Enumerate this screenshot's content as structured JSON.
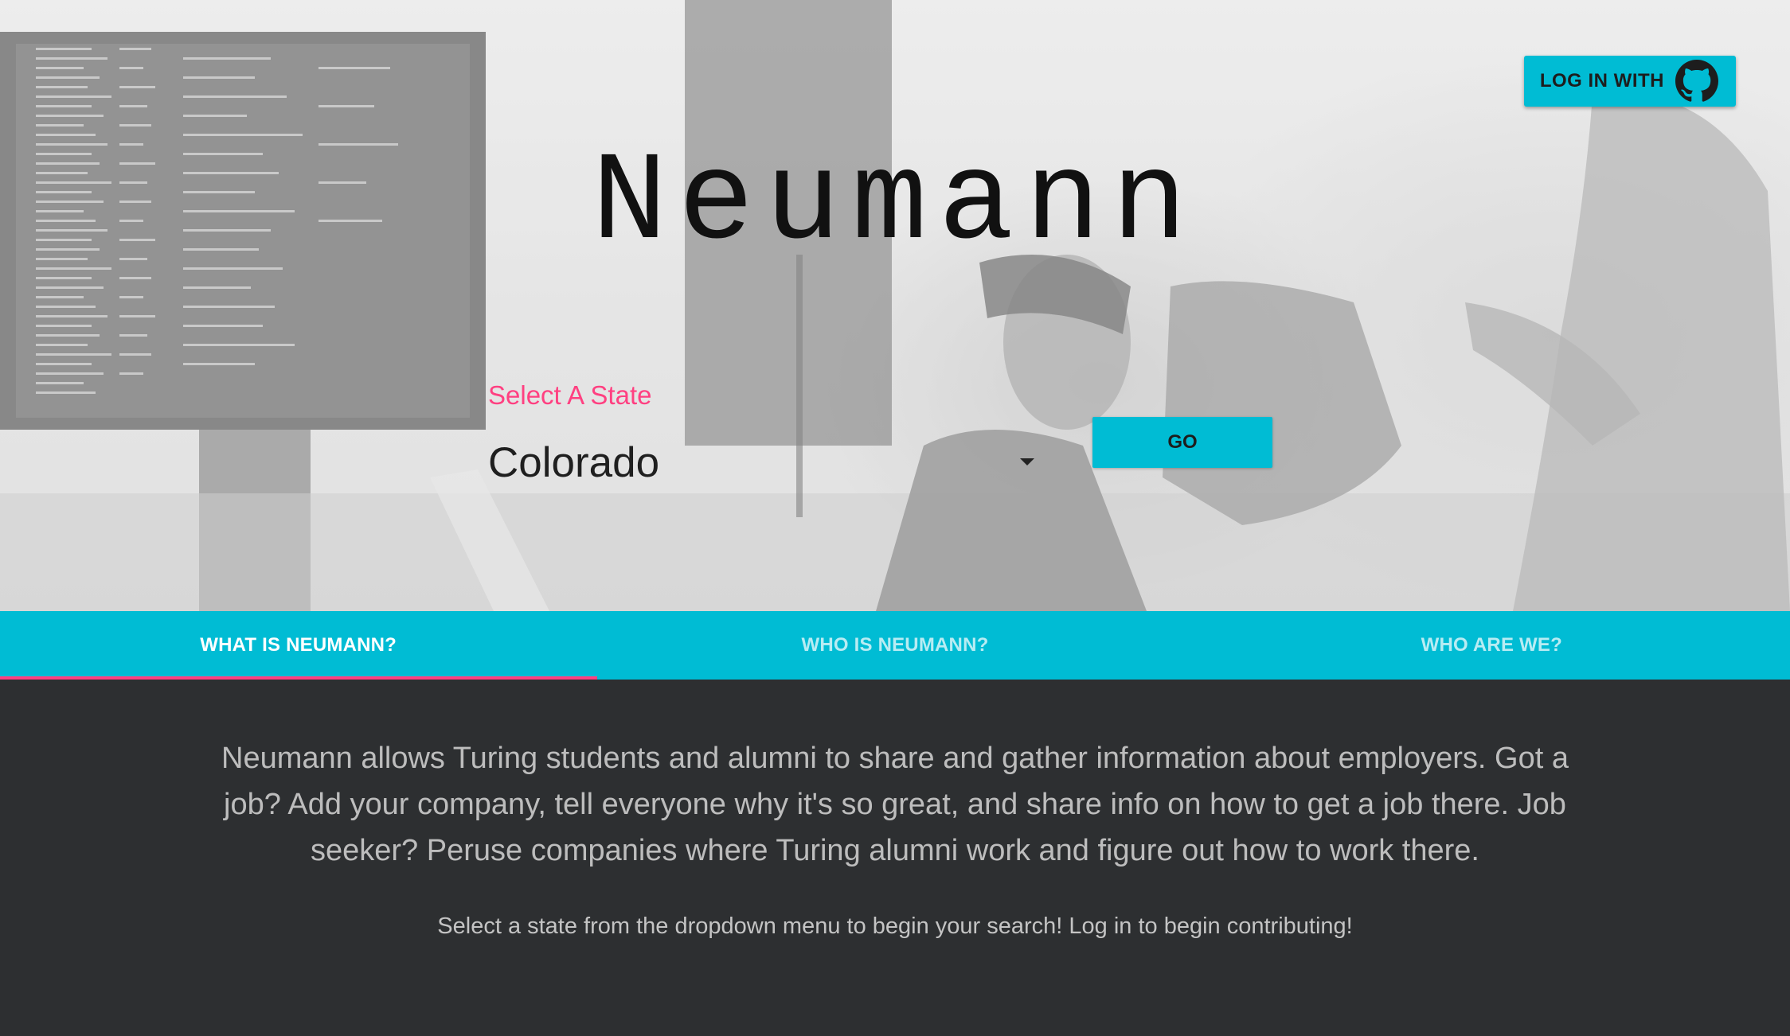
{
  "header": {
    "login_label": "LOG IN WITH",
    "login_icon": "github-icon"
  },
  "hero": {
    "title": "Neumann",
    "select_label": "Select A State",
    "selected_state": "Colorado",
    "go_label": "GO"
  },
  "tabs": [
    {
      "label": "WHAT IS NEUMANN?",
      "active": true
    },
    {
      "label": "WHO IS NEUMANN?",
      "active": false
    },
    {
      "label": "WHO ARE WE?",
      "active": false
    }
  ],
  "content": {
    "description": "Neumann allows Turing students and alumni to share and gather information about employers. Got a job? Add your company, tell everyone why it's so great, and share info on how to get a job there. Job seeker? Peruse companies where Turing alumni work and figure out how to work there.",
    "hint": "Select a state from the dropdown menu to begin your search! Log in to begin contributing!"
  },
  "colors": {
    "accent": "#00bcd4",
    "highlight": "#ff4081",
    "content_bg": "#2d2f31"
  }
}
